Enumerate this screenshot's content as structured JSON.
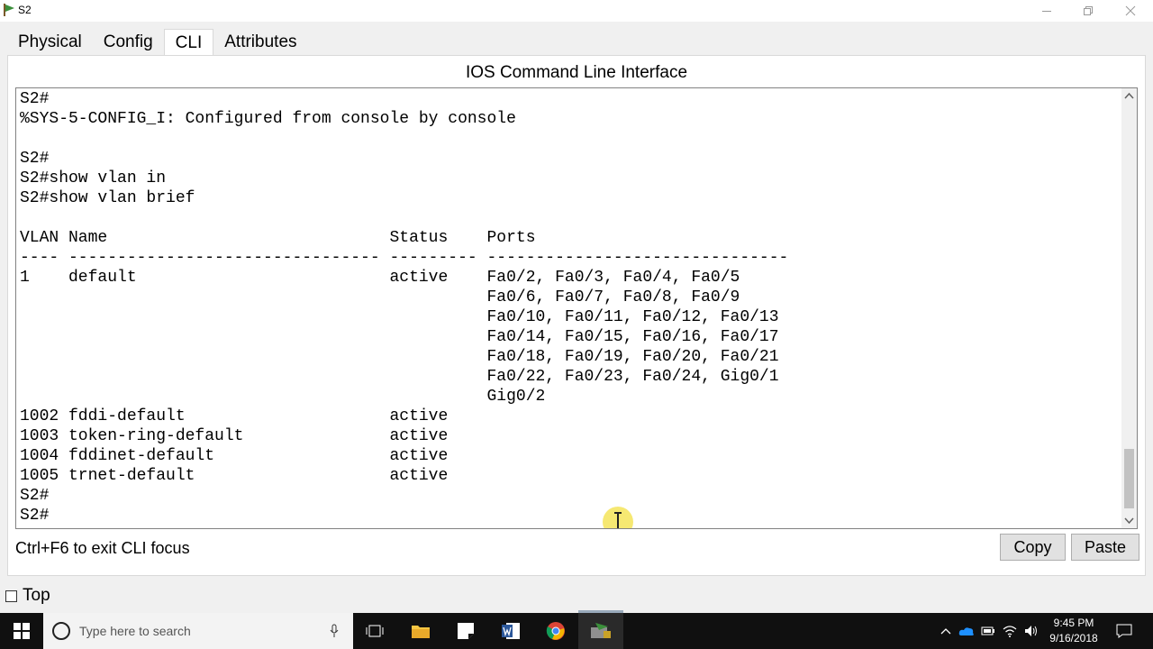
{
  "window": {
    "title": "S2"
  },
  "tabs": [
    {
      "label": "Physical"
    },
    {
      "label": "Config"
    },
    {
      "label": "CLI"
    },
    {
      "label": "Attributes"
    }
  ],
  "cli": {
    "heading": "IOS Command Line Interface",
    "lines": [
      "S2#",
      "%SYS-5-CONFIG_I: Configured from console by console",
      "",
      "S2#",
      "S2#show vlan in",
      "S2#show vlan brief",
      "",
      "VLAN Name                             Status    Ports",
      "---- -------------------------------- --------- -------------------------------",
      "1    default                          active    Fa0/2, Fa0/3, Fa0/4, Fa0/5",
      "                                                Fa0/6, Fa0/7, Fa0/8, Fa0/9",
      "                                                Fa0/10, Fa0/11, Fa0/12, Fa0/13",
      "                                                Fa0/14, Fa0/15, Fa0/16, Fa0/17",
      "                                                Fa0/18, Fa0/19, Fa0/20, Fa0/21",
      "                                                Fa0/22, Fa0/23, Fa0/24, Gig0/1",
      "                                                Gig0/2",
      "1002 fddi-default                     active",
      "1003 token-ring-default               active",
      "1004 fddinet-default                  active",
      "1005 trnet-default                    active",
      "S2#",
      "S2#"
    ],
    "hint": "Ctrl+F6 to exit CLI focus",
    "copy_label": "Copy",
    "paste_label": "Paste"
  },
  "top_checkbox": {
    "label": "Top",
    "checked": false
  },
  "taskbar": {
    "search_placeholder": "Type here to search",
    "time": "9:45 PM",
    "date": "9/16/2018"
  },
  "colors": {
    "accent_active": "#9aabbb",
    "taskbar": "#101010",
    "cursor_marker": "#f5e663"
  },
  "icons": [
    "packet-tracer-icon",
    "minimize-icon",
    "restore-icon",
    "close-icon",
    "windows-start-icon",
    "cortana-icon",
    "microphone-icon",
    "task-view-icon",
    "file-explorer-icon",
    "sticky-notes-icon",
    "word-icon",
    "chrome-icon",
    "packet-tracer-taskbar-icon",
    "chevron-up-icon",
    "onedrive-icon",
    "battery-icon",
    "wifi-icon",
    "volume-icon",
    "notifications-icon"
  ]
}
